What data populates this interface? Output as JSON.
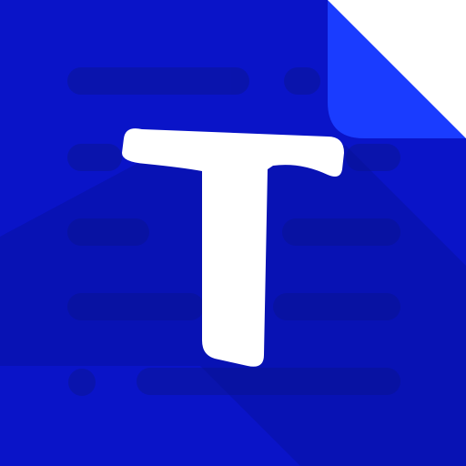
{
  "icon": {
    "name": "text-document-app-icon",
    "glyph": "T",
    "colors": {
      "background": "#0a14c8",
      "fold": "#1a3cff",
      "corner": "#ffffff",
      "text_lines": "#0b14a8",
      "shadow": "#060d8f",
      "glyph": "#ffffff"
    }
  }
}
